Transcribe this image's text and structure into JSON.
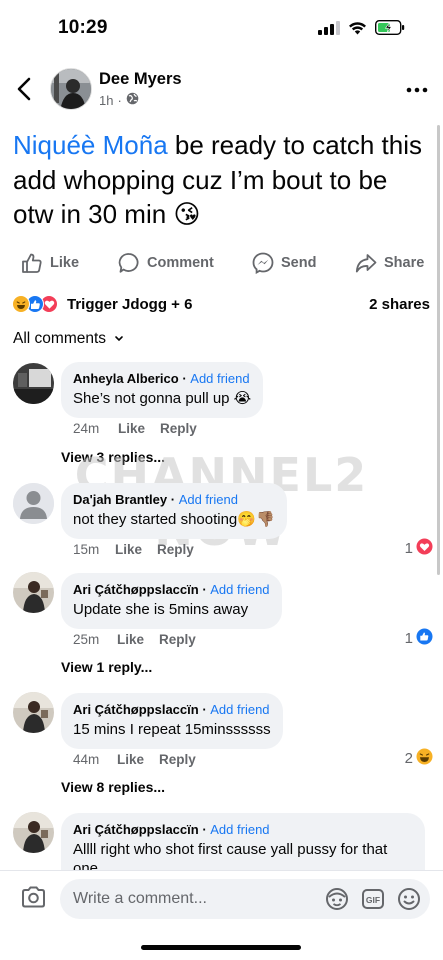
{
  "status_bar": {
    "time": "10:29"
  },
  "post": {
    "author": "Dee Myers",
    "age": "1h",
    "mention": "Niquéè Moña",
    "text": " be ready to catch this add whopping cuz I’m bout to be otw in 30 min 😘"
  },
  "actions": {
    "like": "Like",
    "comment": "Comment",
    "send": "Send",
    "share": "Share"
  },
  "reactions": {
    "names": "Trigger Jdogg + 6",
    "shares": "2 shares"
  },
  "sort": {
    "label": "All comments"
  },
  "watermark": "CHANNEL2 NOW",
  "comments": [
    {
      "name": "Anheyla Alberico",
      "add_friend": "Add friend",
      "text": "She’s not gonna pull up 😭",
      "time": "24m",
      "like": "Like",
      "reply": "Reply",
      "view_replies": "View 3 replies..."
    },
    {
      "name": "Da'jah Brantley",
      "add_friend": "Add friend",
      "text": "not they started shooting🤭👎🏽",
      "time": "15m",
      "like": "Like",
      "reply": "Reply",
      "reaction_count": "1",
      "reaction": "heart"
    },
    {
      "name": "Ari Çátčhøppslaccïn",
      "add_friend": "Add friend",
      "text": "Update she is 5mins away",
      "time": "25m",
      "like": "Like",
      "reply": "Reply",
      "reaction_count": "1",
      "reaction": "like",
      "view_replies": "View 1 reply..."
    },
    {
      "name": "Ari Çátčhøppslaccïn",
      "add_friend": "Add friend",
      "text": "15 mins I repeat 15minssssss",
      "time": "44m",
      "like": "Like",
      "reply": "Reply",
      "reaction_count": "2",
      "reaction": "haha",
      "view_replies": "View 8 replies..."
    },
    {
      "name": "Ari Çátčhøppslaccïn",
      "add_friend": "Add friend",
      "text": "Allll right who shot first cause yall pussy for that one"
    }
  ],
  "composer": {
    "placeholder": "Write a comment..."
  },
  "colors": {
    "brand_blue": "#1877f2",
    "bubble_gray": "#f0f2f5",
    "meta_gray": "#65676b",
    "love_red": "#f33e58"
  }
}
